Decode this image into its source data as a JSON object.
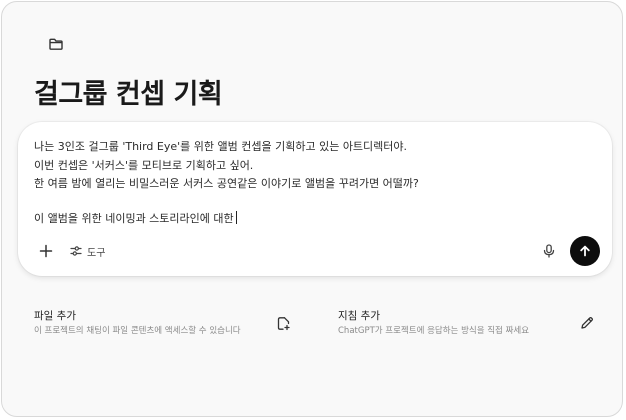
{
  "project": {
    "title": "걸그룹 컨셉 기획",
    "folder_icon": "folder-icon"
  },
  "composer": {
    "lines": [
      "나는 3인조 걸그룹 'Third Eye'를 위한 앨범 컨셉을 기획하고 있는 아트디렉터야.",
      "이번 컨셉은 '서커스'를 모티브로 기획하고 싶어.",
      "한 여름 밤에 열리는 비밀스러운 서커스 공연같은 이야기로 앨범을 꾸려가면 어떨까?",
      "이 앨범을 위한 네이밍과 스토리라인에 대한"
    ],
    "tools_label": "도구",
    "icons": {
      "plus": "plus-icon",
      "tools": "sliders-icon",
      "mic": "microphone-icon",
      "send": "arrow-up-icon"
    }
  },
  "cards": {
    "add_files": {
      "title": "파일 추가",
      "description": "이 프로젝트의 채팅이 파일 콘텐츠에 액세스할 수 있습니다",
      "icon": "add-file-icon"
    },
    "add_instructions": {
      "title": "지침 추가",
      "description": "ChatGPT가 프로젝트에 응답하는 방식을 직접 짜세요",
      "icon": "pencil-icon"
    }
  },
  "colors": {
    "send_button": "#0d0d0d",
    "background": "#f9f9f9",
    "composer_bg": "#ffffff",
    "muted_text": "#8a8a8a"
  }
}
